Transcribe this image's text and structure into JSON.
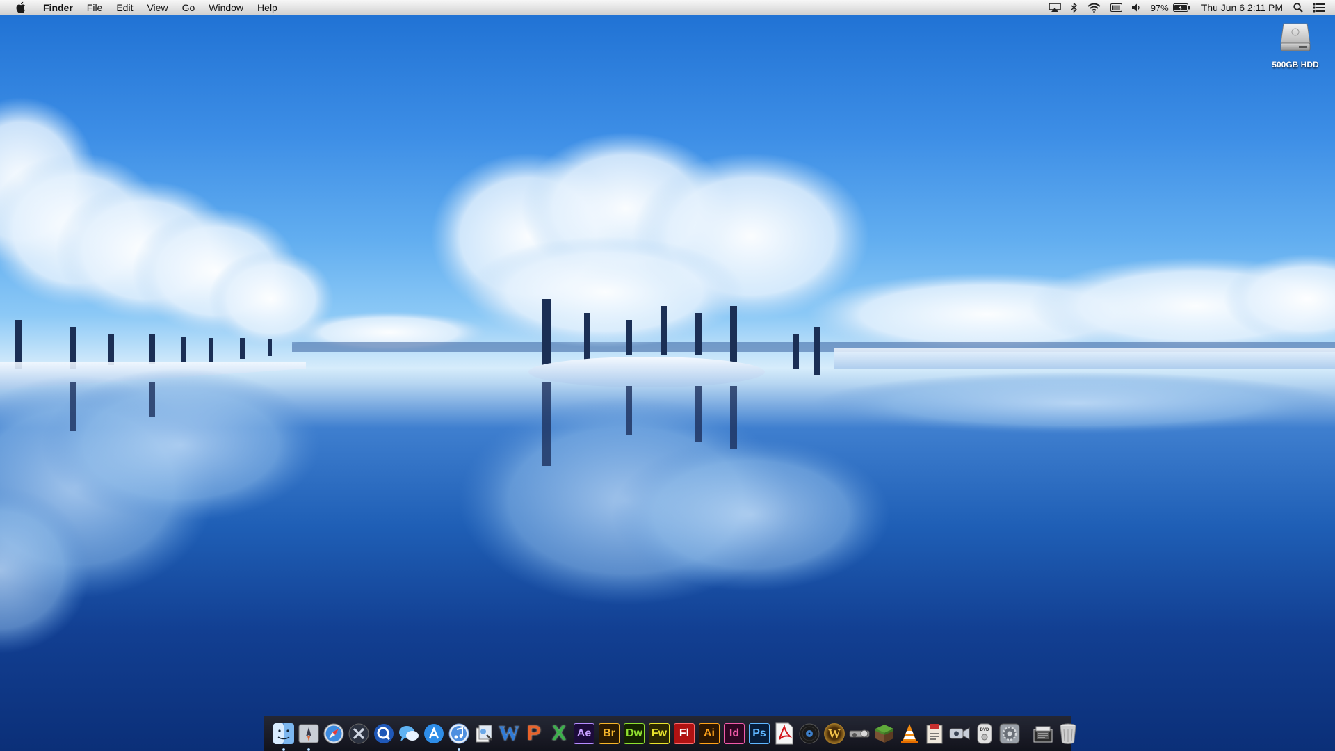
{
  "menubar": {
    "apple_icon": "apple-icon",
    "app_name": "Finder",
    "menus": [
      "File",
      "Edit",
      "View",
      "Go",
      "Window",
      "Help"
    ],
    "status": {
      "airplay_icon": "airplay-icon",
      "bluetooth_icon": "bluetooth-icon",
      "wifi_icon": "wifi-icon",
      "keyboard_icon": "battery-status-icon",
      "volume_icon": "volume-icon",
      "battery_percent": "97%",
      "battery_icon": "battery-icon",
      "clock": "Thu Jun 6  2:11 PM",
      "spotlight_icon": "spotlight-icon",
      "notifications_icon": "notification-center-icon"
    }
  },
  "desktop": {
    "items": [
      {
        "label": "500GB HDD",
        "icon": "hard-drive-icon"
      }
    ]
  },
  "dock": {
    "items": [
      {
        "name": "finder",
        "icon": "finder-icon",
        "running": true
      },
      {
        "name": "launchpad",
        "icon": "launchpad-icon",
        "running": true
      },
      {
        "name": "safari",
        "icon": "safari-icon",
        "running": false
      },
      {
        "name": "mission-control",
        "icon": "mission-control-icon",
        "running": false
      },
      {
        "name": "quicktime",
        "icon": "quicktime-icon",
        "running": false
      },
      {
        "name": "messages",
        "icon": "messages-icon",
        "running": false
      },
      {
        "name": "app-store",
        "icon": "app-store-icon",
        "running": false
      },
      {
        "name": "itunes",
        "icon": "itunes-icon",
        "running": true
      },
      {
        "name": "preview",
        "icon": "preview-icon",
        "running": false
      },
      {
        "name": "word",
        "icon": "word-icon",
        "label": "W",
        "running": false
      },
      {
        "name": "powerpoint",
        "icon": "powerpoint-icon",
        "label": "P",
        "running": false
      },
      {
        "name": "excel",
        "icon": "excel-icon",
        "label": "X",
        "running": false
      },
      {
        "name": "after-effects",
        "icon": "after-effects-icon",
        "label": "Ae",
        "running": false
      },
      {
        "name": "bridge",
        "icon": "bridge-icon",
        "label": "Br",
        "running": false
      },
      {
        "name": "dreamweaver",
        "icon": "dreamweaver-icon",
        "label": "Dw",
        "running": false
      },
      {
        "name": "fireworks",
        "icon": "fireworks-icon",
        "label": "Fw",
        "running": false
      },
      {
        "name": "flash",
        "icon": "flash-icon",
        "label": "Fl",
        "running": false
      },
      {
        "name": "illustrator",
        "icon": "illustrator-icon",
        "label": "Ai",
        "running": false
      },
      {
        "name": "indesign",
        "icon": "indesign-icon",
        "label": "Id",
        "running": false
      },
      {
        "name": "photoshop",
        "icon": "photoshop-icon",
        "label": "Ps",
        "running": false
      },
      {
        "name": "acrobat",
        "icon": "acrobat-icon",
        "running": false
      },
      {
        "name": "logic",
        "icon": "vinyl-icon",
        "running": false
      },
      {
        "name": "world-of-warcraft",
        "icon": "warcraft-icon",
        "label": "W",
        "running": false
      },
      {
        "name": "steam",
        "icon": "steam-icon",
        "running": false
      },
      {
        "name": "minecraft",
        "icon": "minecraft-icon",
        "running": false
      },
      {
        "name": "vlc",
        "icon": "vlc-icon",
        "running": false
      },
      {
        "name": "mail-stamp",
        "icon": "script-editor-icon",
        "running": false
      },
      {
        "name": "facetime",
        "icon": "facetime-icon",
        "running": false
      },
      {
        "name": "dvd-player",
        "icon": "dvd-player-icon",
        "running": false
      },
      {
        "name": "system-preferences",
        "icon": "system-preferences-icon",
        "running": false
      }
    ],
    "stack_items": [
      {
        "name": "documents-stack",
        "icon": "documents-stack-icon"
      },
      {
        "name": "trash",
        "icon": "trash-icon"
      }
    ]
  },
  "colors": {
    "menubar_bg": "#e3e3e3",
    "dock_bg": "#1a1a20",
    "sky_top": "#1d6fd2",
    "water_bottom": "#0b2f78"
  }
}
